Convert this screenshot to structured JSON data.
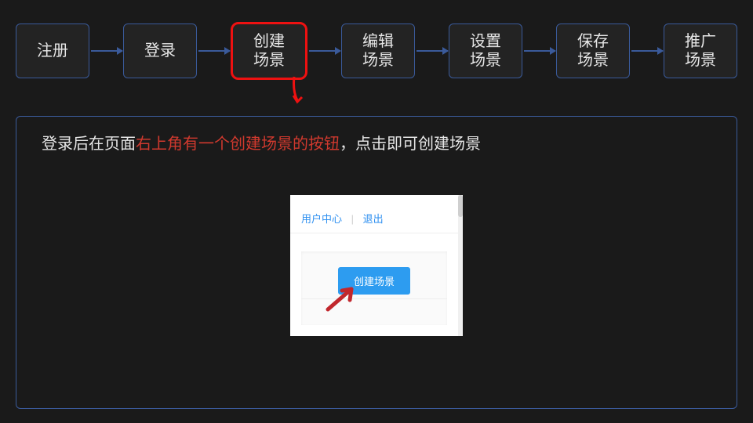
{
  "steps": {
    "s0": "注册",
    "s1": "登录",
    "s2": "创建\n场景",
    "s3": "编辑\n场景",
    "s4": "设置\n场景",
    "s5": "保存\n场景",
    "s6": "推广\n场景"
  },
  "active_step_index": 2,
  "description": {
    "pre": "登录后在页面",
    "highlight": "右上角有一个创建场景的按钮",
    "post": "，点击即可创建场景"
  },
  "screenshot": {
    "user_center": "用户中心",
    "separator": "|",
    "logout": "退出",
    "create_button": "创建场景"
  }
}
